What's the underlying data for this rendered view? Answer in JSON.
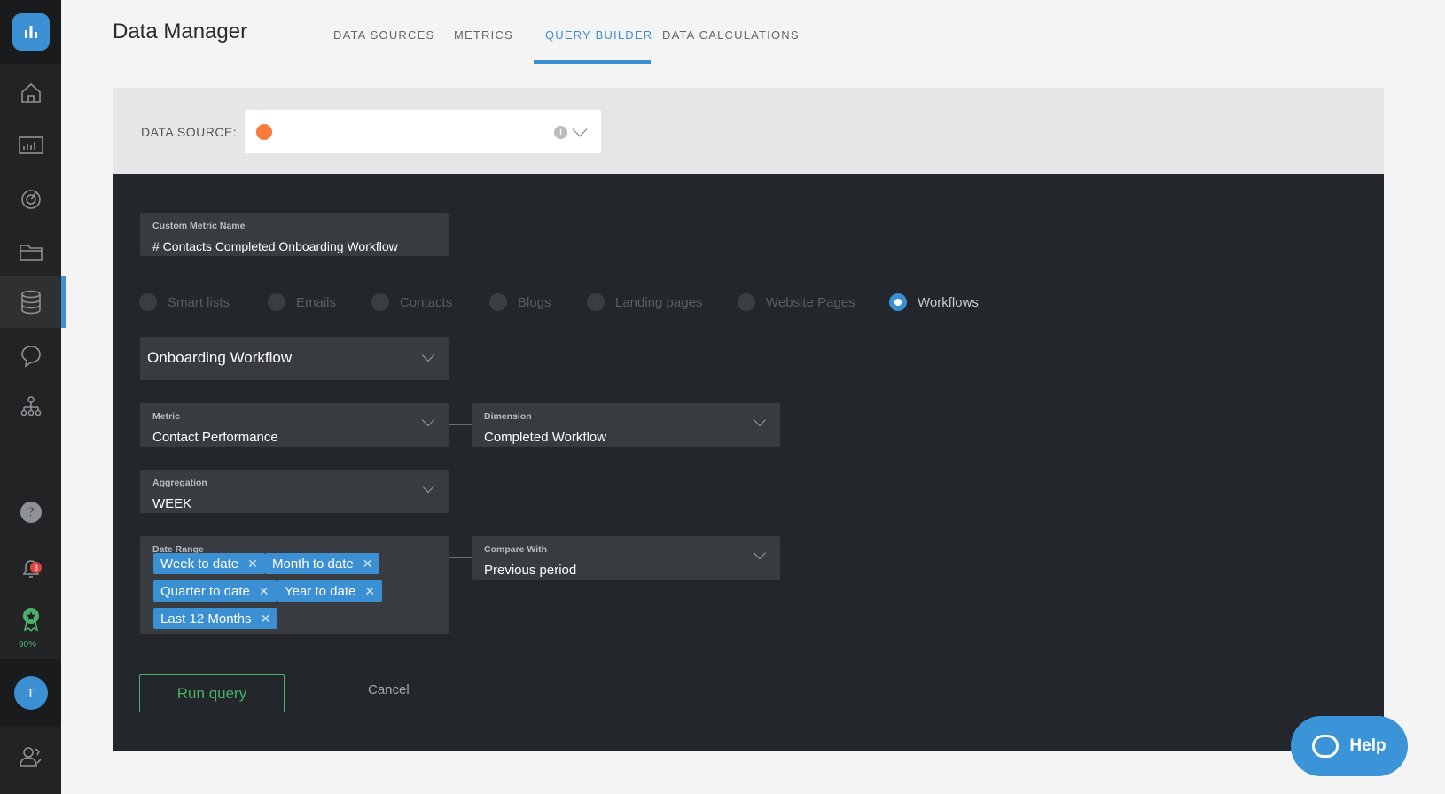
{
  "app": {
    "title": "Data Manager"
  },
  "tabs": [
    {
      "label": "DATA SOURCES",
      "active": false
    },
    {
      "label": "METRICS",
      "active": false
    },
    {
      "label": "QUERY BUILDER",
      "active": true
    },
    {
      "label": "DATA CALCULATIONS",
      "active": false
    }
  ],
  "sidebar": {
    "items": [
      "home-icon",
      "dashboard-icon",
      "goals-icon",
      "folder-icon",
      "database-icon",
      "chat-icon",
      "org-chart-icon"
    ],
    "notifications_count": "3",
    "progress_label": "90%",
    "avatar_initial": "T"
  },
  "data_source": {
    "label": "DATA SOURCE:",
    "selected_icon": "hubspot-icon"
  },
  "form": {
    "custom_metric_name": {
      "label": "Custom Metric Name",
      "value": "# Contacts Completed Onboarding Workflow"
    },
    "source_types": [
      {
        "label": "Smart lists",
        "selected": false
      },
      {
        "label": "Emails",
        "selected": false
      },
      {
        "label": "Contacts",
        "selected": false
      },
      {
        "label": "Blogs",
        "selected": false
      },
      {
        "label": "Landing pages",
        "selected": false
      },
      {
        "label": "Website Pages",
        "selected": false
      },
      {
        "label": "Workflows",
        "selected": true
      }
    ],
    "workflow_select": {
      "value": "Onboarding Workflow"
    },
    "metric": {
      "label": "Metric",
      "value": "Contact Performance"
    },
    "dimension": {
      "label": "Dimension",
      "value": "Completed Workflow"
    },
    "aggregation": {
      "label": "Aggregation",
      "value": "WEEK"
    },
    "date_range": {
      "label": "Date Range",
      "chips": [
        "Week to date",
        "Month to date",
        "Quarter to date",
        "Year to date",
        "Last 12 Months"
      ]
    },
    "compare_with": {
      "label": "Compare With",
      "value": "Previous period"
    },
    "run_label": "Run query",
    "cancel_label": "Cancel"
  },
  "help": {
    "label": "Help"
  },
  "colors": {
    "accent": "#3b8fd3",
    "success": "#4caf6a",
    "panel_dark": "#23272b"
  }
}
